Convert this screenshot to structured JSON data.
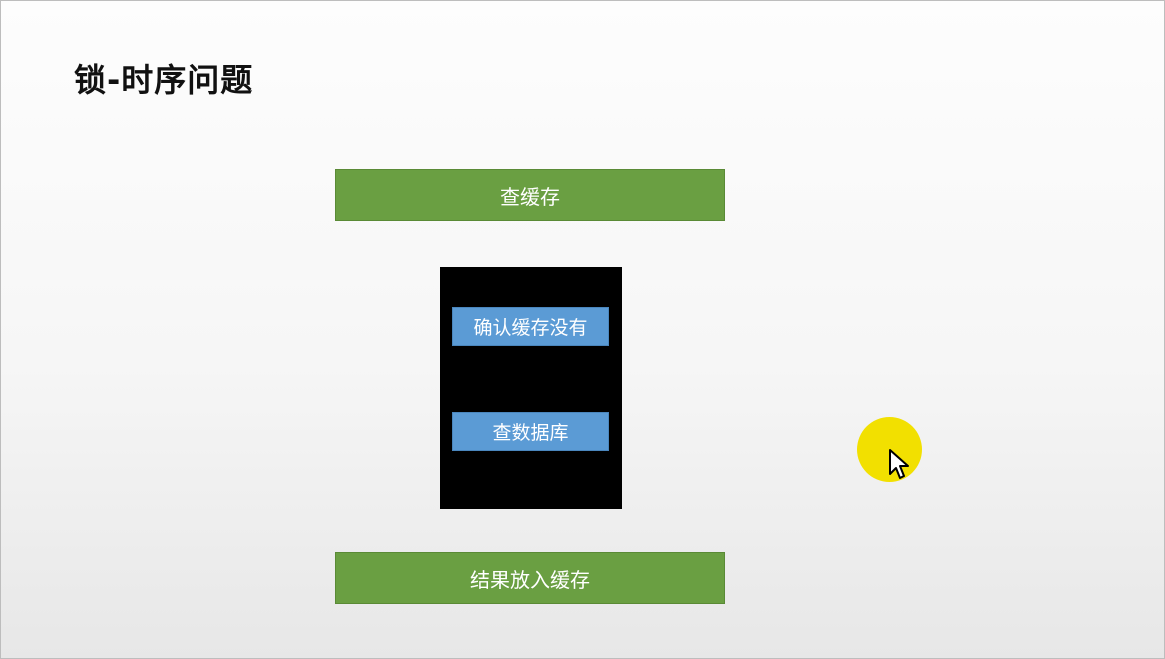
{
  "slide": {
    "title": "锁-时序问题"
  },
  "flow": {
    "step_query_cache": "查缓存",
    "lock_region": {
      "step_confirm_no_cache": "确认缓存没有",
      "step_query_db": "查数据库"
    },
    "step_put_result_in_cache": "结果放入缓存"
  },
  "colors": {
    "green_step": "#6a9f42",
    "blue_step": "#5b9bd5",
    "lock_region": "#000000",
    "cursor_highlight": "#f2e000"
  },
  "icons": {
    "cursor": "mouse-pointer-icon"
  }
}
